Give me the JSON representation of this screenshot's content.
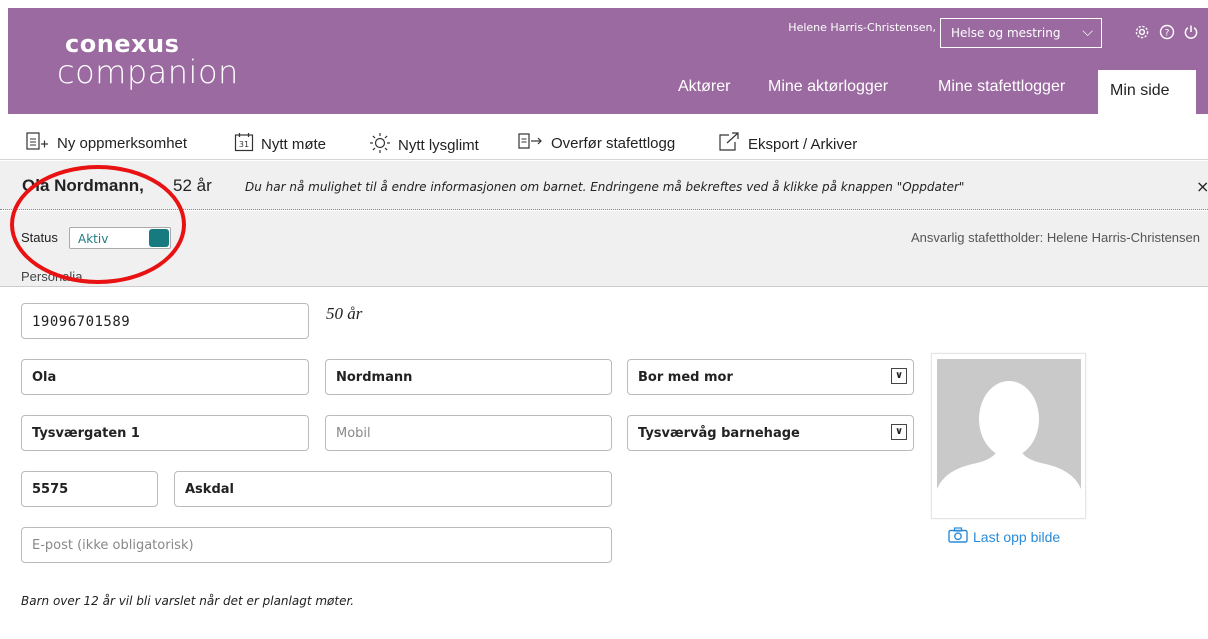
{
  "header": {
    "logo_top": "conexus",
    "logo_bottom": "companion",
    "username": "Helene Harris-Christensen,",
    "role_select": "Helse og mestring",
    "nav": [
      "Aktører",
      "Mine aktørlogger",
      "Mine stafettlogger",
      "Min side"
    ],
    "active_nav": "Min side",
    "colors": {
      "header_bg": "#9a6aa0"
    },
    "icons": [
      "gear-icon",
      "help-icon",
      "power-icon"
    ]
  },
  "toolbar": {
    "new_attention": "Ny oppmerksomhet",
    "new_meeting": "Nytt møte",
    "new_glimpse": "Nytt lysglimt",
    "transfer": "Overfør stafettlogg",
    "export": "Eksport / Arkiver",
    "meeting_day": "31"
  },
  "info": {
    "name": "Ola Nordmann,",
    "age": "52 år",
    "message": "Du har nå mulighet til å endre informasjonen om barnet. Endringene må bekreftes ved å klikke på knappen \"Oppdater\"",
    "close": "×"
  },
  "status": {
    "label": "Status",
    "value": "Aktiv",
    "responsible": "Ansvarlig stafettholder: Helene Harris-Christensen",
    "section": "Personalia",
    "toggle_color": "#177a80"
  },
  "form": {
    "ssn": "19096701589",
    "age_display": "50 år",
    "first_name": "Ola",
    "last_name": "Nordmann",
    "living": "Bor med mor",
    "address": "Tysværgaten 1",
    "mobile_placeholder": "Mobil",
    "kindergarten": "Tysværvåg barnehage",
    "postal_code": "5575",
    "city": "Askdal",
    "email_placeholder": "E-post (ikke obligatorisk)",
    "upload_label": "Last opp bilde",
    "footnote": "Barn over 12 år vil bli varslet når det er planlagt møter."
  }
}
